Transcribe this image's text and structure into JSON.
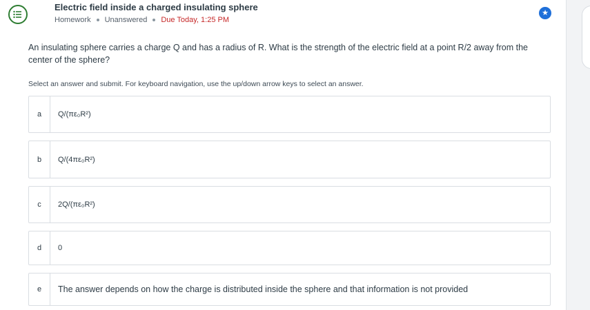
{
  "header": {
    "title": "Electric field inside a charged insulating sphere",
    "meta_type": "Homework",
    "meta_status": "Unanswered",
    "meta_due": "Due Today, 1:25 PM"
  },
  "question": {
    "text": "An insulating sphere carries a charge Q and has a radius of R. What is the strength of the electric field at a point R/2 away from the center of the sphere?"
  },
  "instructions": "Select an answer and submit. For keyboard navigation, use the up/down arrow keys to select an answer.",
  "options": [
    {
      "letter": "a",
      "text": "Q/(πε₀R²)"
    },
    {
      "letter": "b",
      "text": "Q/(4πε₀R²)"
    },
    {
      "letter": "c",
      "text": "2Q/(πε₀R²)"
    },
    {
      "letter": "d",
      "text": "0"
    },
    {
      "letter": "e",
      "text": "The answer depends on how the charge is distributed inside the sphere and that information is not provided"
    }
  ],
  "colors": {
    "accent": "#1e6fd9",
    "due": "#c62828",
    "question_icon": "#2e7d32"
  },
  "icons": {
    "question_type": "list-question-icon",
    "star": "star-icon"
  }
}
